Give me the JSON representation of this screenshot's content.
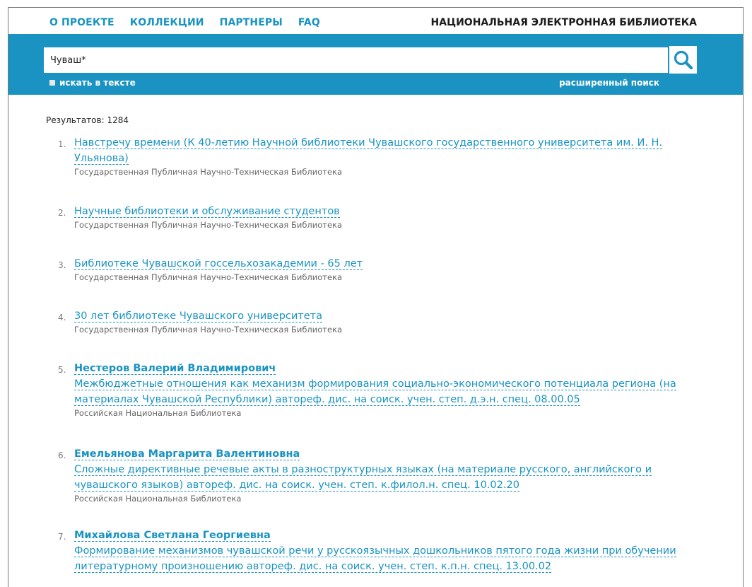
{
  "nav": {
    "items": [
      "О ПРОЕКТЕ",
      "КОЛЛЕКЦИИ",
      "ПАРТНЕРЫ",
      "FAQ"
    ],
    "brand": "НАЦИОНАЛЬНАЯ ЭЛЕКТРОННАЯ БИБЛИОТЕКА"
  },
  "search": {
    "value": "Чуваш*",
    "checkbox_label": "искать в тексте",
    "advanced_label": "расширенный поиск",
    "button_icon": "search-icon"
  },
  "results_count": "Результатов: 1284",
  "results": [
    {
      "num": "1.",
      "author": "",
      "title": "Навстречу времени (К 40-летию Научной библиотеки Чувашского государственного университета им. И. Н. Ульянова)",
      "source": "Государственная Публичная Научно-Техническая Библиотека"
    },
    {
      "num": "2.",
      "author": "",
      "title": "Научные библиотеки и обслуживание студентов",
      "source": "Государственная Публичная Научно-Техническая Библиотека"
    },
    {
      "num": "3.",
      "author": "",
      "title": "Библиотеке Чувашской госсельхозакадемии - 65 лет",
      "source": "Государственная Публичная Научно-Техническая Библиотека"
    },
    {
      "num": "4.",
      "author": "",
      "title": "30 лет библиотеке Чувашского университета",
      "source": "Государственная Публичная Научно-Техническая Библиотека"
    },
    {
      "num": "5.",
      "author": "Нестеров Валерий Владимирович",
      "title": "Межбюджетные отношения как механизм формирования социально-экономического потенциала региона (на материалах Чувашской Республики) автореф. дис. на соиск. учен. степ. д.э.н. спец. 08.00.05",
      "source": "Российская Национальная Библиотека"
    },
    {
      "num": "6.",
      "author": "Емельянова Маргарита Валентиновна",
      "title": "Сложные директивные речевые акты в разноструктурных языках (на материале русского, английского и чувашского языков) автореф. дис. на соиск. учен. степ. к.филол.н. спец. 10.02.20",
      "source": "Российская Национальная Библиотека"
    },
    {
      "num": "7.",
      "author": "Михайлова Светлана Георгиевна",
      "title": "Формирование механизмов чувашской речи у русскоязычных дошкольников пятого года жизни при обучении литературному произношению автореф. дис. на соиск. учен. степ. к.п.н. спец. 13.00.02",
      "source": ""
    }
  ],
  "colors": {
    "accent": "#1a93c2",
    "source_text": "#666666"
  }
}
